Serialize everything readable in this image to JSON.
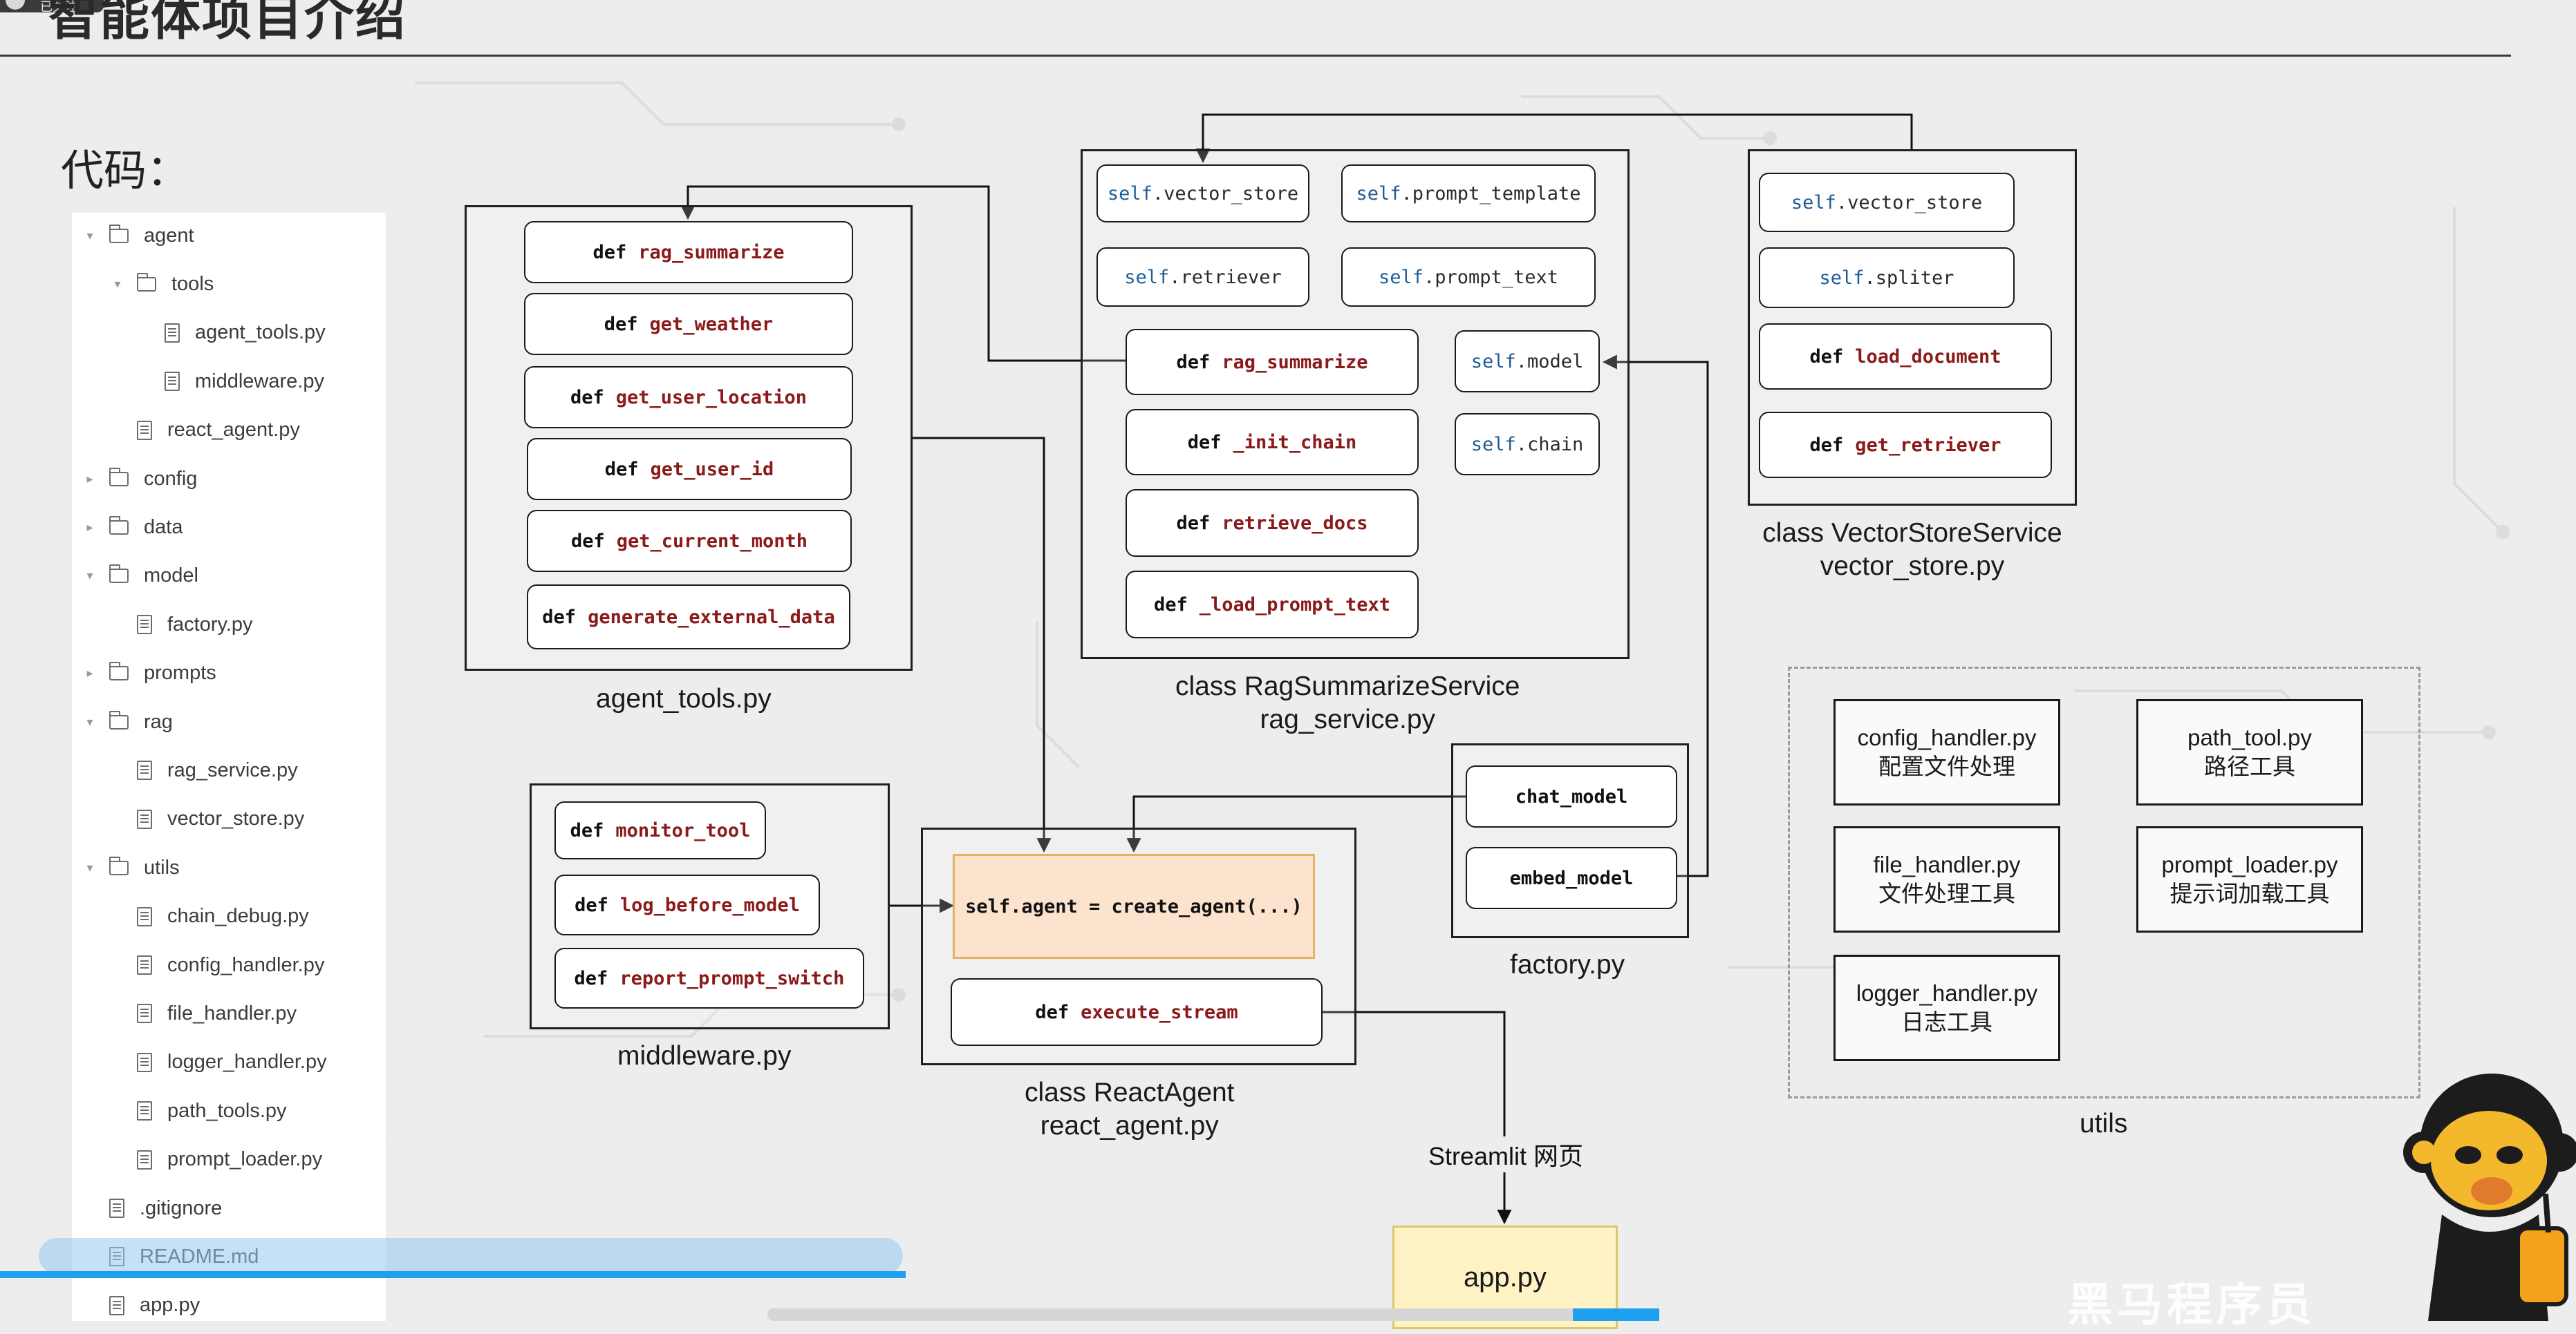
{
  "slide": {
    "title": "智能体项目介绍",
    "code_label": "代码：",
    "badge_text": "已关注"
  },
  "file_tree": [
    {
      "name": "agent",
      "kind": "folder",
      "depth": 0,
      "expanded": true
    },
    {
      "name": "tools",
      "kind": "folder",
      "depth": 1,
      "expanded": true
    },
    {
      "name": "agent_tools.py",
      "kind": "file",
      "depth": 2
    },
    {
      "name": "middleware.py",
      "kind": "file",
      "depth": 2
    },
    {
      "name": "react_agent.py",
      "kind": "file",
      "depth": 1
    },
    {
      "name": "config",
      "kind": "folder",
      "depth": 0,
      "expanded": false
    },
    {
      "name": "data",
      "kind": "folder",
      "depth": 0,
      "expanded": false
    },
    {
      "name": "model",
      "kind": "folder",
      "depth": 0,
      "expanded": true
    },
    {
      "name": "factory.py",
      "kind": "file",
      "depth": 1
    },
    {
      "name": "prompts",
      "kind": "folder",
      "depth": 0,
      "expanded": false
    },
    {
      "name": "rag",
      "kind": "folder",
      "depth": 0,
      "expanded": true
    },
    {
      "name": "rag_service.py",
      "kind": "file",
      "depth": 1
    },
    {
      "name": "vector_store.py",
      "kind": "file",
      "depth": 1
    },
    {
      "name": "utils",
      "kind": "folder",
      "depth": 0,
      "expanded": true
    },
    {
      "name": "chain_debug.py",
      "kind": "file",
      "depth": 1
    },
    {
      "name": "config_handler.py",
      "kind": "file",
      "depth": 1
    },
    {
      "name": "file_handler.py",
      "kind": "file",
      "depth": 1
    },
    {
      "name": "logger_handler.py",
      "kind": "file",
      "depth": 1
    },
    {
      "name": "path_tools.py",
      "kind": "file",
      "depth": 1
    },
    {
      "name": "prompt_loader.py",
      "kind": "file",
      "depth": 1
    },
    {
      "name": ".gitignore",
      "kind": "file",
      "depth": 0
    },
    {
      "name": "README.md",
      "kind": "file",
      "depth": 0
    },
    {
      "name": "app.py",
      "kind": "file",
      "depth": 0
    }
  ],
  "keywords": {
    "def": "def",
    "self": "self"
  },
  "agent_tools": {
    "caption": "agent_tools.py",
    "methods": [
      "rag_summarize",
      "get_weather",
      "get_user_location",
      "get_user_id",
      "get_current_month",
      "generate_external_data"
    ]
  },
  "rag_service": {
    "caption_line1": "class RagSummarizeService",
    "caption_line2": "rag_service.py",
    "attrs": [
      ".vector_store",
      ".prompt_template",
      ".retriever",
      ".prompt_text",
      ".model",
      ".chain"
    ],
    "methods": [
      "rag_summarize",
      "_init_chain",
      "retrieve_docs",
      "_load_prompt_text"
    ]
  },
  "vector_store": {
    "caption_line1": "class VectorStoreService",
    "caption_line2": "vector_store.py",
    "attrs": [
      ".vector_store",
      ".spliter"
    ],
    "methods": [
      "load_document",
      "get_retriever"
    ]
  },
  "middleware": {
    "caption": "middleware.py",
    "methods": [
      "monitor_tool",
      "log_before_model",
      "report_prompt_switch"
    ]
  },
  "react_agent": {
    "caption_line1": "class ReactAgent",
    "caption_line2": "react_agent.py",
    "agent_line": "self.agent = create_agent(...)",
    "method": "execute_stream"
  },
  "factory": {
    "caption": "factory.py",
    "items": [
      "chat_model",
      "embed_model"
    ]
  },
  "utils": {
    "caption": "utils",
    "boxes": [
      {
        "line1": "config_handler.py",
        "line2": "配置文件处理"
      },
      {
        "line1": "path_tool.py",
        "line2": "路径工具"
      },
      {
        "line1": "file_handler.py",
        "line2": "文件处理工具"
      },
      {
        "line1": "prompt_loader.py",
        "line2": "提示词加载工具"
      },
      {
        "line1": "logger_handler.py",
        "line2": "日志工具"
      }
    ]
  },
  "app": {
    "stream_label": "Streamlit 网页",
    "label": "app.py"
  },
  "overlay": {
    "watermark": "黑马程序员"
  }
}
